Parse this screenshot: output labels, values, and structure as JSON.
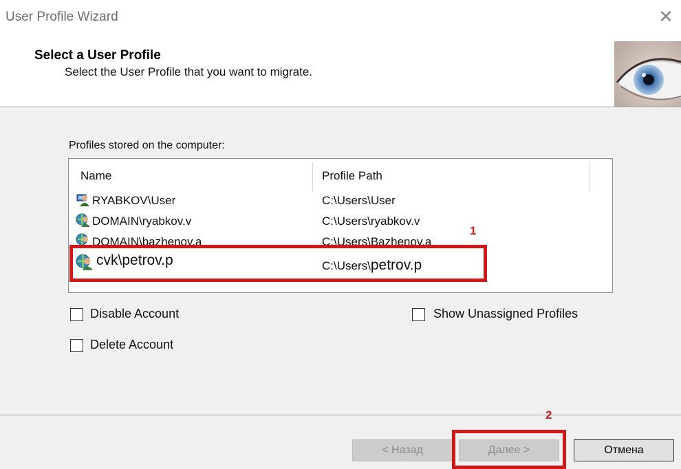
{
  "window": {
    "title": "User Profile Wizard"
  },
  "header": {
    "title": "Select a User Profile",
    "subtitle": "Select the User Profile that you want to migrate."
  },
  "profiles": {
    "label": "Profiles stored on the computer:",
    "columns": [
      "Name",
      "Profile Path"
    ],
    "rows": [
      {
        "name": "RYABKOV\\User",
        "path": "C:\\Users\\User",
        "icon": "local-user-icon"
      },
      {
        "name": "DOMAIN\\ryabkov.v",
        "path": "C:\\Users\\ryabkov.v",
        "icon": "domain-user-icon"
      },
      {
        "name": "DOMAIN\\bazhenov.a",
        "path": "C:\\Users\\Bazhenov.a",
        "icon": "domain-user-icon"
      },
      {
        "name": "cvk\\petrov.p",
        "path_prefix": "C:\\Users\\",
        "path_user": "petrov.p",
        "icon": "domain-user-icon"
      }
    ]
  },
  "options": {
    "disable_account": "Disable Account",
    "delete_account": "Delete Account",
    "show_unassigned": "Show Unassigned Profiles"
  },
  "annotations": {
    "marker1": "1",
    "marker2": "2",
    "color": "#d01818"
  },
  "buttons": {
    "back": "< Назад",
    "next": "Далее >",
    "cancel": "Отмена"
  }
}
